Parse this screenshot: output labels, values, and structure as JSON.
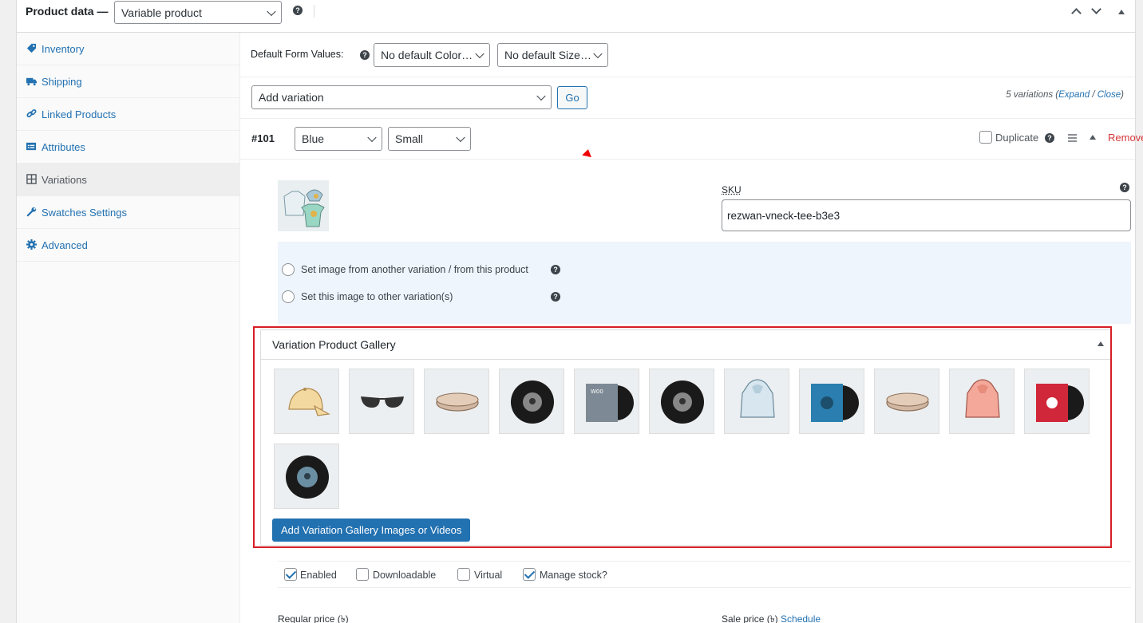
{
  "header": {
    "title": "Product data —",
    "product_type": "Variable product",
    "help": "?"
  },
  "sidebar": {
    "items": [
      {
        "label": "Inventory",
        "icon": "tag-icon"
      },
      {
        "label": "Shipping",
        "icon": "truck-icon"
      },
      {
        "label": "Linked Products",
        "icon": "link-icon"
      },
      {
        "label": "Attributes",
        "icon": "list-icon"
      },
      {
        "label": "Variations",
        "icon": "grid-icon"
      },
      {
        "label": "Swatches Settings",
        "icon": "wrench-icon"
      },
      {
        "label": "Advanced",
        "icon": "gear-icon"
      }
    ],
    "active": "Variations"
  },
  "defaults": {
    "label": "Default Form Values:",
    "color_select": "No default Color…",
    "size_select": "No default Size…"
  },
  "add_variation": {
    "select": "Add variation",
    "go": "Go",
    "count_prefix": "5 variations (",
    "expand": "Expand",
    "slash": " / ",
    "close": "Close",
    "count_suffix": ")"
  },
  "variation": {
    "id": "#101",
    "color": "Blue",
    "size": "Small",
    "duplicate": "Duplicate",
    "remove": "Remove",
    "sku_label": "SKU",
    "sku_value": "rezwan-vneck-tee-b3e3",
    "radio_1": "Set image from another variation / from this product",
    "radio_2": "Set this image to other variation(s)"
  },
  "gallery": {
    "title": "Variation Product Gallery",
    "button": "Add Variation Gallery Images or Videos",
    "images": [
      "cap",
      "sunglasses",
      "belt",
      "vinyl-record",
      "album-gray",
      "vinyl-record",
      "hoodie-blue",
      "album-blue",
      "belt",
      "hoodie-pink",
      "album-red",
      "vinyl-blue"
    ]
  },
  "options": {
    "enabled": "Enabled",
    "downloadable": "Downloadable",
    "virtual": "Virtual",
    "manage_stock": "Manage stock?"
  },
  "prices": {
    "regular": "Regular price (৳)",
    "sale": "Sale price (৳)",
    "schedule": "Schedule"
  },
  "colors": {
    "accent": "#2271b1",
    "remove": "#d63638",
    "highlight": "#d61f26"
  }
}
